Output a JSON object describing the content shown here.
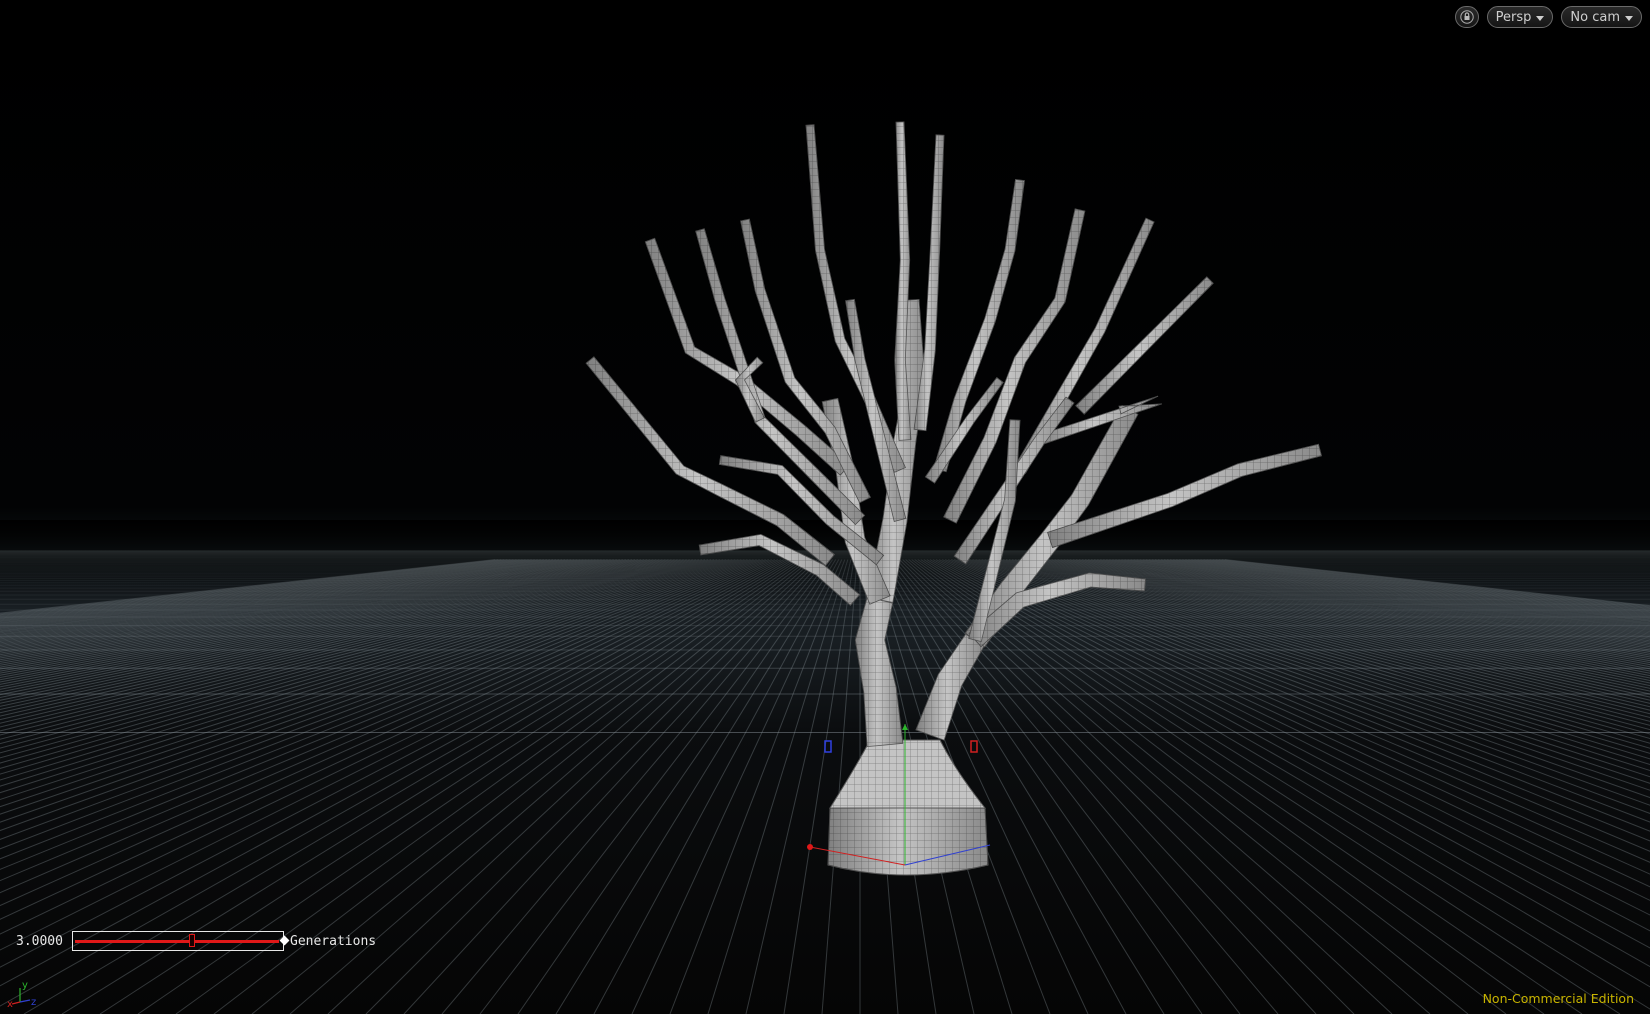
{
  "toolbar": {
    "lock_icon": "lock-icon",
    "view_label": "Persp",
    "camera_label": "No cam"
  },
  "handle": {
    "value": "3.0000",
    "label": "Generations",
    "fraction": 0.57
  },
  "footer": {
    "edition": "Non-Commercial Edition"
  },
  "axis_gizmo": {
    "x": "x",
    "y": "y",
    "z": "z"
  },
  "colors": {
    "background": "#000000",
    "grid": "#8a949c",
    "geometry": "#b8b8b8",
    "slider": "#e01818",
    "edition": "#c8b400"
  }
}
